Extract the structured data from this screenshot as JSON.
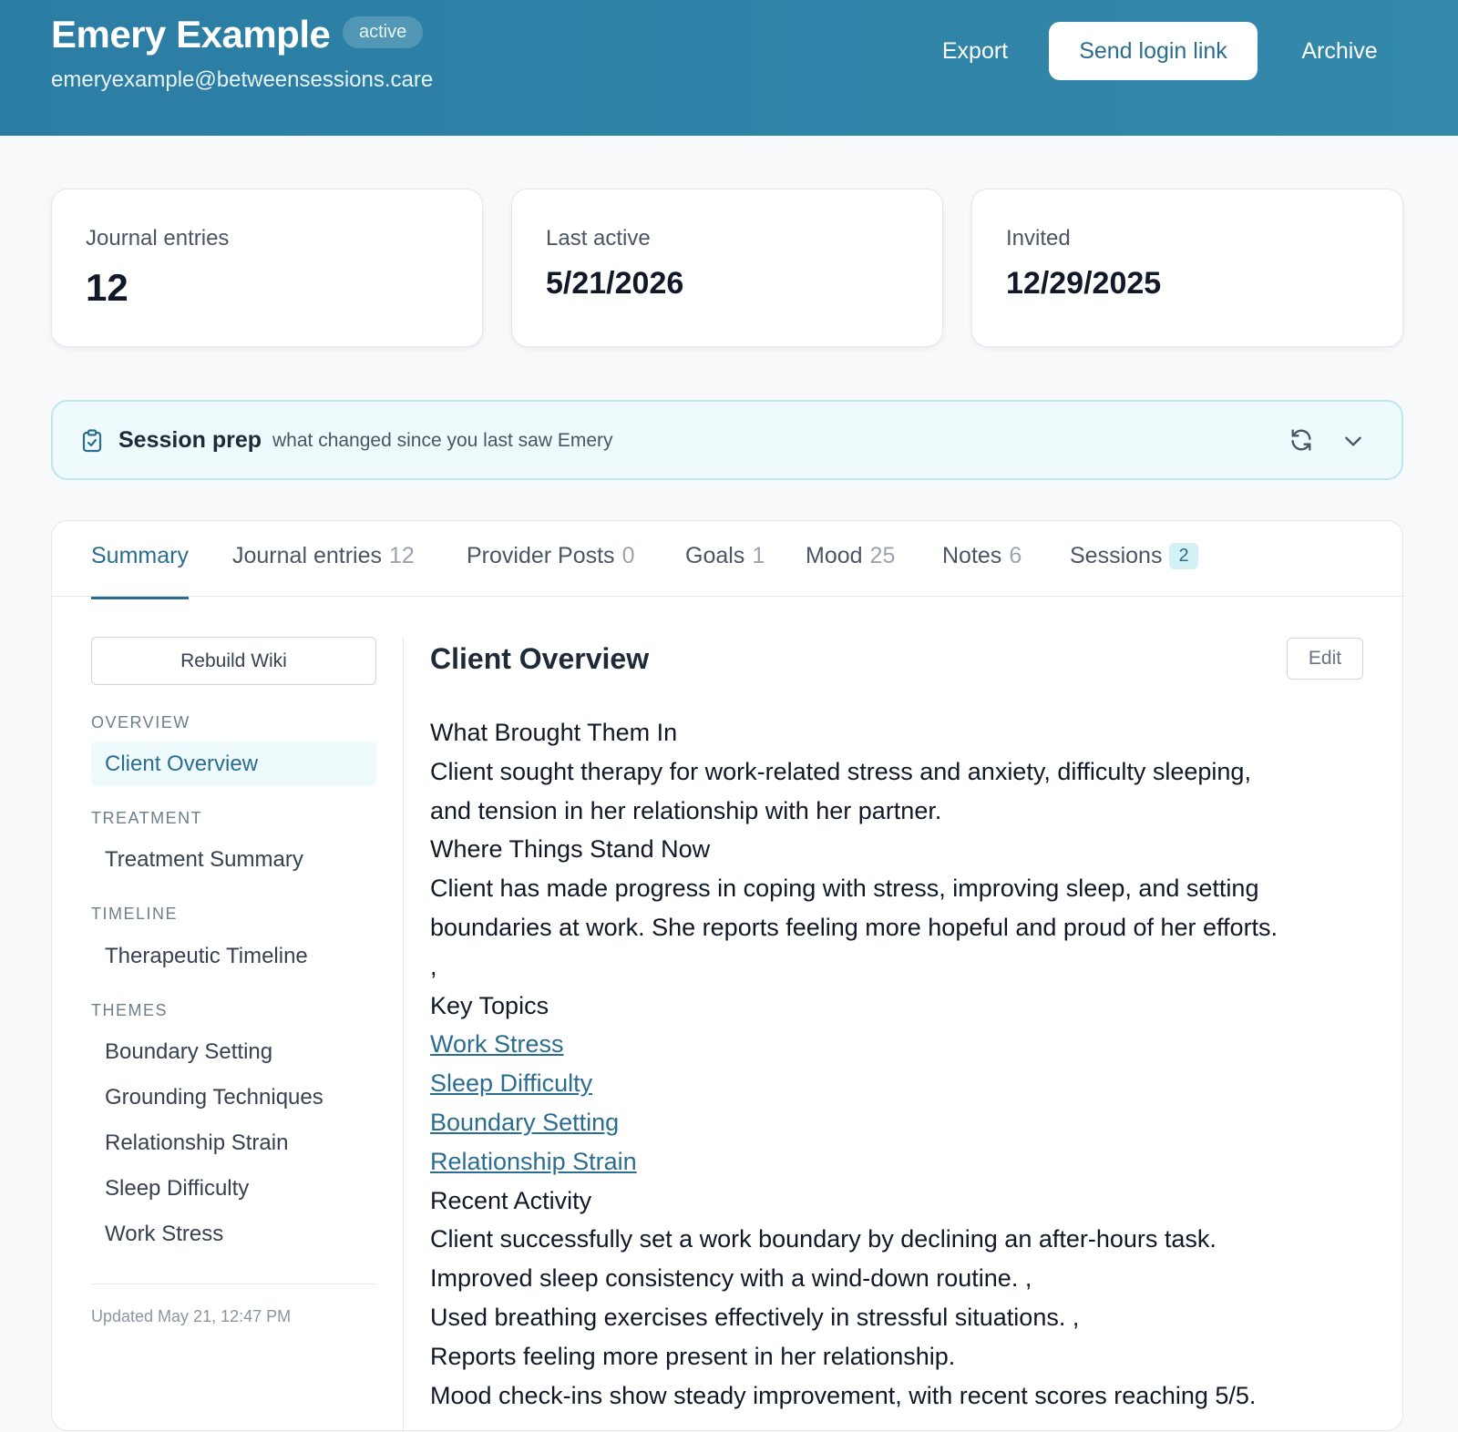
{
  "header": {
    "name": "Emery Example",
    "status": "active",
    "email": "emeryexample@betweensessions.care",
    "export": "Export",
    "send_login_link": "Send login link",
    "archive": "Archive"
  },
  "stats": [
    {
      "label": "Journal entries",
      "value": "12"
    },
    {
      "label": "Last active",
      "value": "5/21/2026"
    },
    {
      "label": "Invited",
      "value": "12/29/2025"
    }
  ],
  "session_prep": {
    "title": "Session prep",
    "subtitle": "what changed since you last saw Emery",
    "icon": "clipboard-check-icon"
  },
  "tabs": [
    {
      "label": "Summary",
      "count": ""
    },
    {
      "label": "Journal entries",
      "count": "12"
    },
    {
      "label": "Provider Posts",
      "count": "0"
    },
    {
      "label": "Goals",
      "count": "1"
    },
    {
      "label": "Mood",
      "count": "25"
    },
    {
      "label": "Notes",
      "count": "6"
    },
    {
      "label": "Sessions",
      "count": "2"
    }
  ],
  "sidebar": {
    "rebuild": "Rebuild Wiki",
    "sections": [
      {
        "title": "OVERVIEW",
        "items": [
          "Client Overview"
        ]
      },
      {
        "title": "TREATMENT",
        "items": [
          "Treatment Summary"
        ]
      },
      {
        "title": "TIMELINE",
        "items": [
          "Therapeutic Timeline"
        ]
      },
      {
        "title": "THEMES",
        "items": [
          "Boundary Setting",
          "Grounding Techniques",
          "Relationship Strain",
          "Sleep Difficulty",
          "Work Stress"
        ]
      }
    ],
    "updated": "Updated May 21, 12:47 PM"
  },
  "content": {
    "title": "Client Overview",
    "edit": "Edit",
    "lines": [
      "What Brought Them In",
      "Client sought therapy for work-related stress and anxiety, difficulty sleeping,",
      "and tension in her relationship with her partner.",
      "Where Things Stand Now",
      "Client has made progress in coping with stress, improving sleep, and setting",
      "boundaries at work. She reports feeling more hopeful and proud of her efforts.",
      ",",
      "Key Topics",
      "Work Stress",
      "Sleep Difficulty",
      "Boundary Setting",
      "Relationship Strain",
      "Recent Activity",
      "Client successfully set a work boundary by declining an after-hours task.",
      "Improved sleep consistency with a wind-down routine. ,",
      "Used breathing exercises effectively in stressful situations. ,",
      "Reports feeling more present in her relationship.",
      "Mood check-ins show steady improvement, with recent scores reaching 5/5."
    ]
  }
}
